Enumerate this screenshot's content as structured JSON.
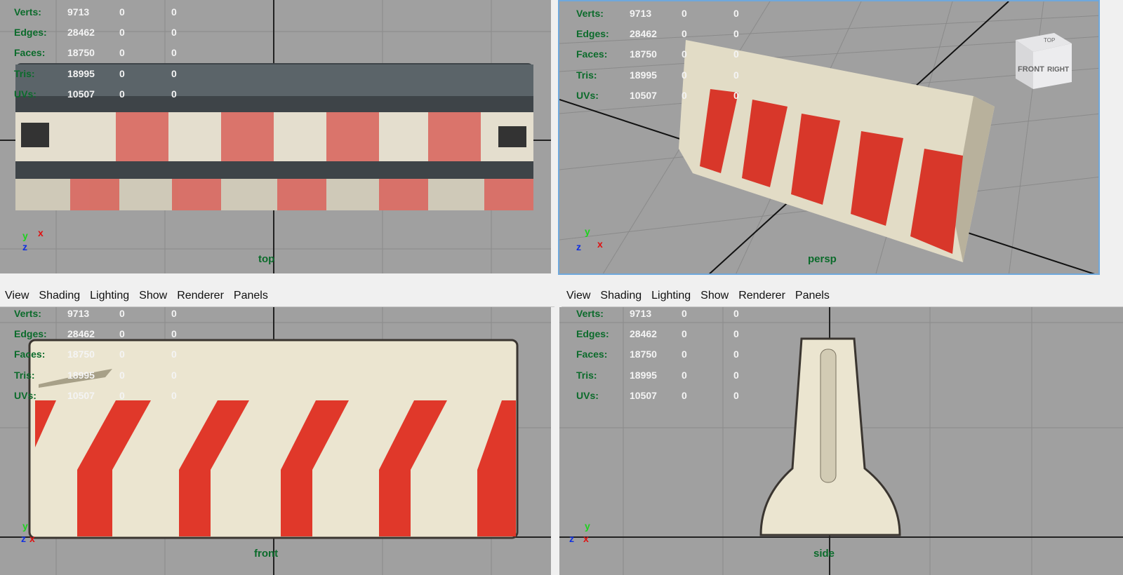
{
  "menu": [
    "View",
    "Shading",
    "Lighting",
    "Show",
    "Renderer",
    "Panels"
  ],
  "stat_labels": [
    "Verts:",
    "Edges:",
    "Faces:",
    "Tris:",
    "UVs:"
  ],
  "stat_values": [
    [
      "9713",
      "0",
      "0"
    ],
    [
      "28462",
      "0",
      "0"
    ],
    [
      "18750",
      "0",
      "0"
    ],
    [
      "18995",
      "0",
      "0"
    ],
    [
      "10507",
      "0",
      "0"
    ]
  ],
  "viewports": {
    "top": {
      "camera": "top",
      "axes": [
        "y",
        "x",
        "z"
      ]
    },
    "persp": {
      "camera": "persp",
      "axes": [
        "y",
        "z",
        "x"
      ],
      "viewcube": [
        "TOP",
        "FRONT",
        "RIGHT"
      ]
    },
    "front": {
      "camera": "front",
      "axes": [
        "y",
        "z",
        "x"
      ]
    },
    "side": {
      "camera": "side",
      "axes": [
        "y",
        "z",
        "x"
      ]
    }
  },
  "colors": {
    "viewport_bg": "#a0a0a0",
    "stat_label": "#0b6b2b",
    "active_border": "#6fa8dc",
    "stripe": "#d83a2a",
    "concrete": "#e8e2cc"
  }
}
